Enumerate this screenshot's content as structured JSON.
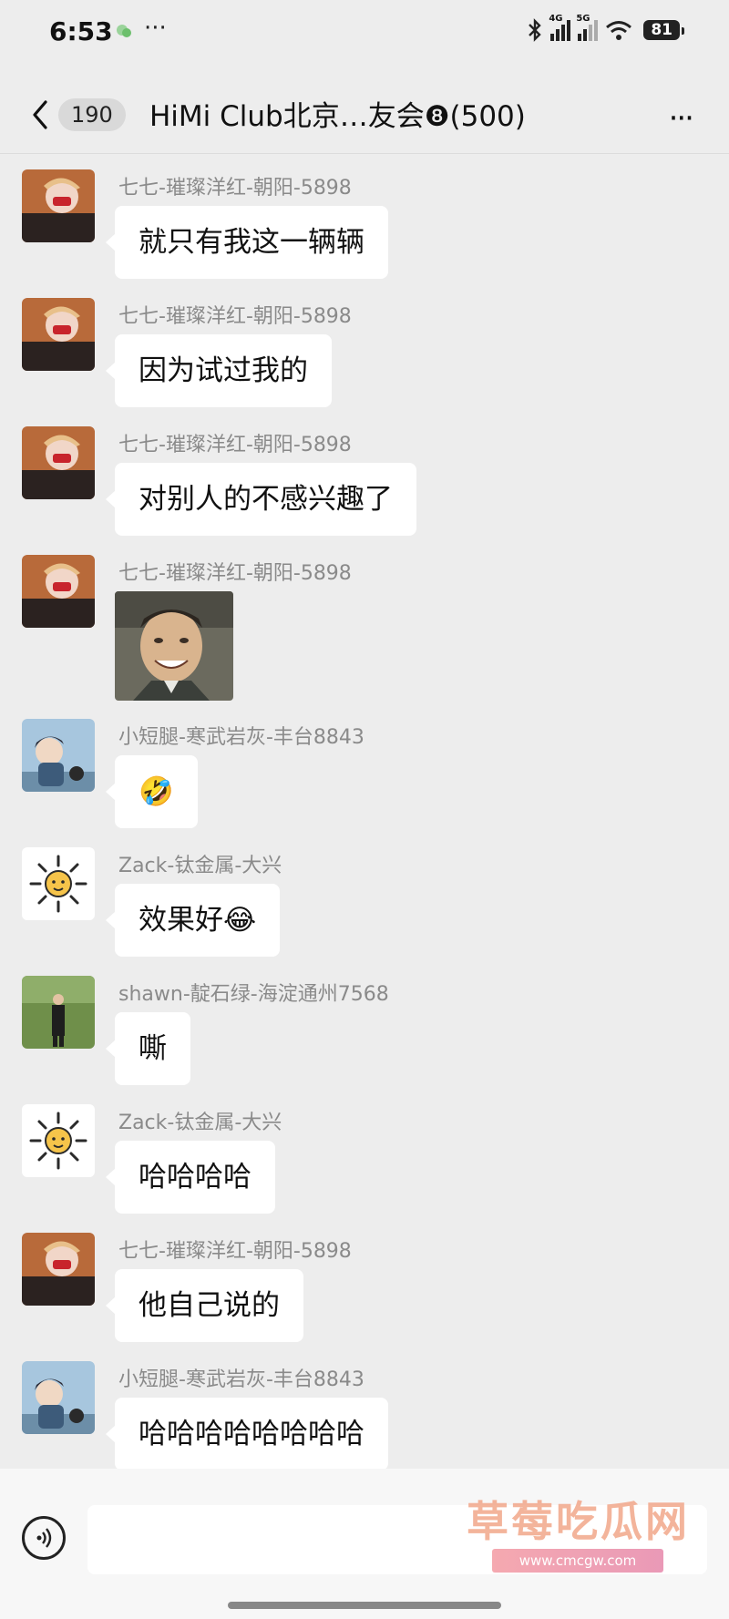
{
  "status_bar": {
    "time": "6:53",
    "dots": "···",
    "battery": "81",
    "net1": "4G",
    "net2": "5G"
  },
  "header": {
    "back_count": "190",
    "title": "HiMi Club北京…友会❽(500)",
    "more": "···"
  },
  "messages": [
    {
      "sender": "七七-璀璨洋红-朝阳-5898",
      "text": "就只有我这一辆辆"
    },
    {
      "sender": "七七-璀璨洋红-朝阳-5898",
      "text": "因为试过我的"
    },
    {
      "sender": "七七-璀璨洋红-朝阳-5898",
      "text": "对别人的不感兴趣了"
    },
    {
      "sender": "七七-璀璨洋红-朝阳-5898",
      "text": ""
    },
    {
      "sender": "小短腿-寒武岩灰-丰台8843",
      "text": "🤣"
    },
    {
      "sender": "Zack-钛金属-大兴",
      "text": "效果好😂"
    },
    {
      "sender": "shawn-靛石绿-海淀通州7568",
      "text": "嘶"
    },
    {
      "sender": "Zack-钛金属-大兴",
      "text": "哈哈哈哈"
    },
    {
      "sender": "七七-璀璨洋红-朝阳-5898",
      "text": "他自己说的"
    },
    {
      "sender": "小短腿-寒武岩灰-丰台8843",
      "text": "哈哈哈哈哈哈哈哈"
    }
  ],
  "watermark": {
    "title": "草莓吃瓜网",
    "url": "www.cmcgw.com"
  },
  "colors": {
    "background": "#ededed",
    "bubble": "#ffffff",
    "sender": "#8a8a8a"
  }
}
